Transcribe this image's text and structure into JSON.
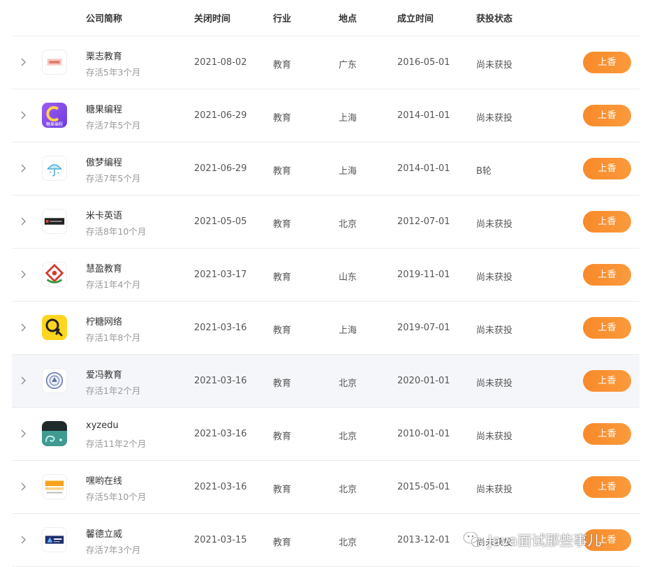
{
  "header": {
    "company": "公司简称",
    "closed": "关闭时间",
    "industry": "行业",
    "location": "地点",
    "founded": "成立时间",
    "funding": "获投状态"
  },
  "rows": [
    {
      "name": "栗志教育",
      "survived": "存活5年3个月",
      "closed": "2021-08-02",
      "industry": "教育",
      "location": "广东",
      "founded": "2016-05-01",
      "funding": "尚未获投",
      "action": "上香",
      "logo": "lizhi-logo"
    },
    {
      "name": "糖果编程",
      "survived": "存活7年5个月",
      "closed": "2021-06-29",
      "industry": "教育",
      "location": "上海",
      "founded": "2014-01-01",
      "funding": "尚未获投",
      "action": "上香",
      "logo": "tangguo-logo",
      "logo_text": "糖果编程"
    },
    {
      "name": "傲梦编程",
      "survived": "存活7年5个月",
      "closed": "2021-06-29",
      "industry": "教育",
      "location": "上海",
      "founded": "2014-01-01",
      "funding": "B轮",
      "action": "上香",
      "logo": "aomeng-logo"
    },
    {
      "name": "米卡英语",
      "survived": "存活8年10个月",
      "closed": "2021-05-05",
      "industry": "教育",
      "location": "北京",
      "founded": "2012-07-01",
      "funding": "尚未获投",
      "action": "上香",
      "logo": "mika-logo"
    },
    {
      "name": "慧盈教育",
      "survived": "存活1年4个月",
      "closed": "2021-03-17",
      "industry": "教育",
      "location": "山东",
      "founded": "2019-11-01",
      "funding": "尚未获投",
      "action": "上香",
      "logo": "huiying-logo"
    },
    {
      "name": "柠糖网络",
      "survived": "存活1年8个月",
      "closed": "2021-03-16",
      "industry": "教育",
      "location": "上海",
      "founded": "2019-07-01",
      "funding": "尚未获投",
      "action": "上香",
      "logo": "ningtang-logo"
    },
    {
      "name": "爱冯教育",
      "survived": "存活1年2个月",
      "closed": "2021-03-16",
      "industry": "教育",
      "location": "北京",
      "founded": "2020-01-01",
      "funding": "尚未获投",
      "action": "上香",
      "logo": "aifeng-logo"
    },
    {
      "name": "xyzedu",
      "survived": "存活11年2个月",
      "closed": "2021-03-16",
      "industry": "教育",
      "location": "北京",
      "founded": "2010-01-01",
      "funding": "尚未获投",
      "action": "上香",
      "logo": "xyzedu-logo"
    },
    {
      "name": "嘿哟在线",
      "survived": "存活5年10个月",
      "closed": "2021-03-16",
      "industry": "教育",
      "location": "北京",
      "founded": "2015-05-01",
      "funding": "尚未获投",
      "action": "上香",
      "logo": "heiyo-logo"
    },
    {
      "name": "馨德立威",
      "survived": "存活7年3个月",
      "closed": "2021-03-15",
      "industry": "教育",
      "location": "北京",
      "founded": "2013-12-01",
      "funding": "尚未获投",
      "action": "上香",
      "logo": "xinde-logo"
    }
  ],
  "highlight_row": 6,
  "watermark": "Java面试那些事儿",
  "colors": {
    "accent": "#f88a2a",
    "text": "#333333",
    "muted": "#999999",
    "row_highlight": "#f5f6fa",
    "divider": "#ececec"
  }
}
